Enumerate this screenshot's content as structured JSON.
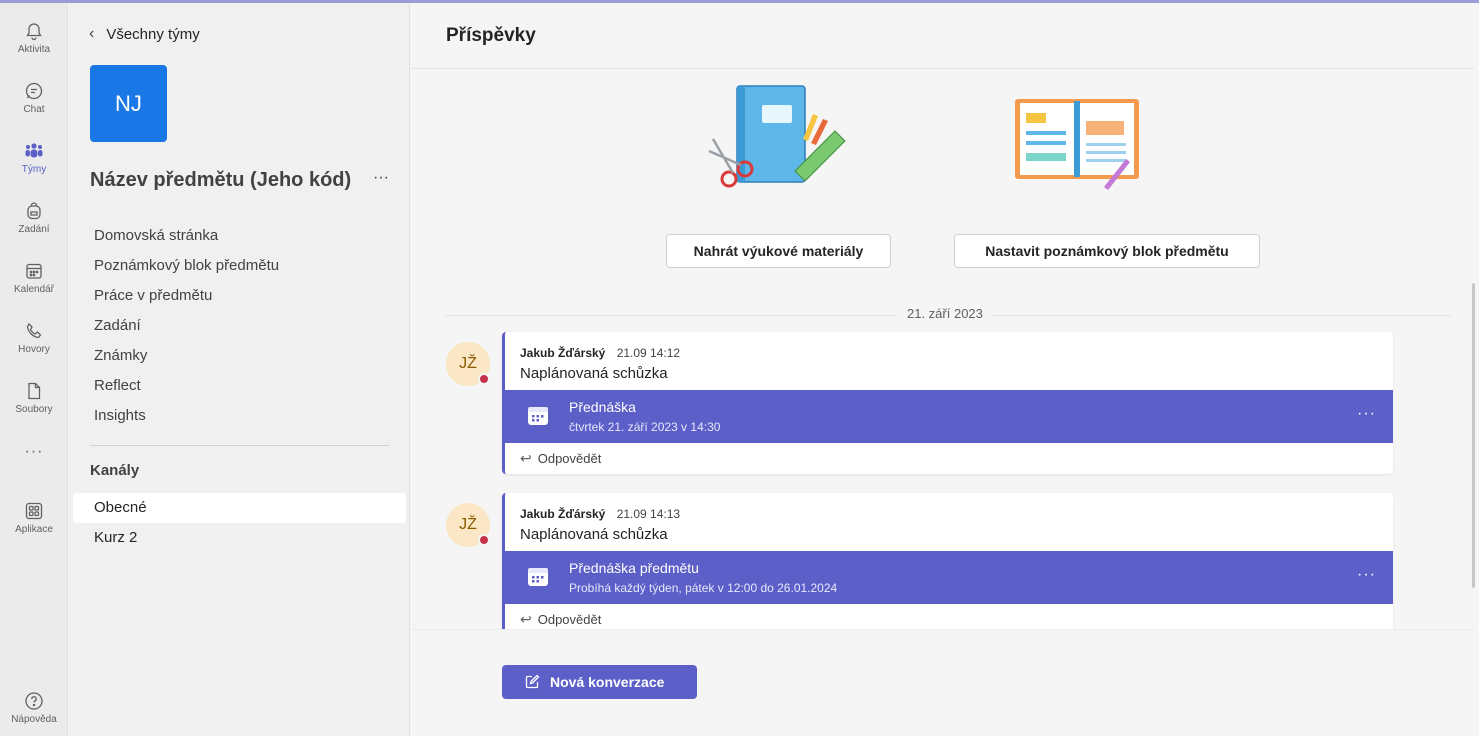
{
  "rail": {
    "items": [
      {
        "label": "Aktivita",
        "icon": "bell-icon"
      },
      {
        "label": "Chat",
        "icon": "chat-icon"
      },
      {
        "label": "Týmy",
        "icon": "teams-icon"
      },
      {
        "label": "Zadání",
        "icon": "backpack-icon"
      },
      {
        "label": "Kalendář",
        "icon": "calendar-icon"
      },
      {
        "label": "Hovory",
        "icon": "phone-icon"
      },
      {
        "label": "Soubory",
        "icon": "file-icon"
      }
    ],
    "more": "···",
    "apps_label": "Aplikace",
    "help_label": "Nápověda"
  },
  "sidebar": {
    "back_label": "Všechny týmy",
    "team_initials": "NJ",
    "team_name": "Název předmětu (Jeho kód)",
    "team_more": "···",
    "nav": [
      "Domovská stránka",
      "Poznámkový blok předmětu",
      "Práce v předmětu",
      "Zadání",
      "Známky",
      "Reflect",
      "Insights"
    ],
    "channels_heading": "Kanály",
    "channels": [
      "Obecné",
      "Kurz 2"
    ],
    "active_channel": "Obecné"
  },
  "main": {
    "title": "Příspěvky",
    "cta_upload": "Nahrát výukové materiály",
    "cta_notebook": "Nastavit poznámkový blok předmětu",
    "date_separator": "21. září 2023",
    "posts": [
      {
        "initials": "JŽ",
        "author": "Jakub Žďárský",
        "time": "21.09 14:12",
        "subject": "Naplánovaná schůzka",
        "meeting_title": "Přednáška",
        "meeting_detail": "čtvrtek 21. září 2023 v 14:30",
        "reply": "Odpovědět"
      },
      {
        "initials": "JŽ",
        "author": "Jakub Žďárský",
        "time": "21.09 14:13",
        "subject": "Naplánovaná schůzka",
        "meeting_title": "Přednáška předmětu",
        "meeting_detail": "Probíhá každý týden, pátek v 12:00 do 26.01.2024",
        "reply": "Odpovědět"
      }
    ],
    "new_conversation": "Nová konverzace"
  },
  "colors": {
    "accent": "#5b5fc7",
    "team_avatar": "#1978e6",
    "presence_busy": "#c4314b"
  }
}
